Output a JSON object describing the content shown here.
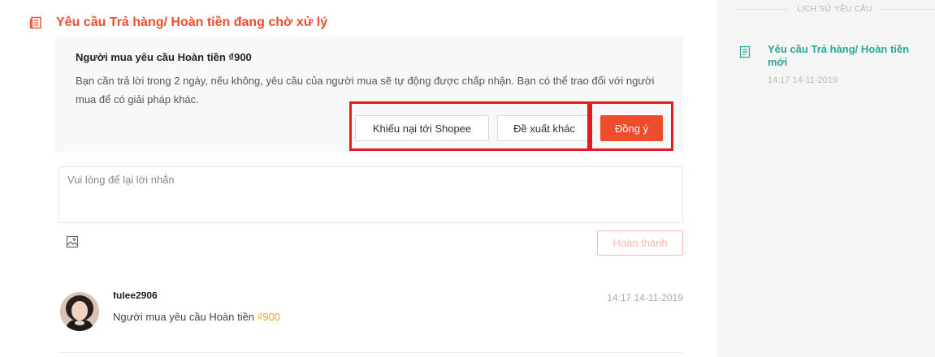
{
  "header": {
    "title": "Yêu cầu Trả hàng/ Hoàn tiền đang chờ xử lý",
    "icon": "document-icon"
  },
  "request": {
    "title": "Người mua yêu cầu Hoàn tiền ₫900",
    "description": "Bạn cần trả lời trong 2 ngày, nếu không, yêu cầu của người mua sẽ tự động được chấp nhận. Bạn có thể trao đổi với người mua để có giải pháp khác.",
    "buttons": {
      "complain": "Khiếu nại tới Shopee",
      "propose": "Đề xuất khác",
      "accept": "Đồng ý"
    }
  },
  "message": {
    "placeholder": "Vui lòng để lại lời nhắn",
    "image_icon": "image-icon",
    "submit_label": "Hoàn thành"
  },
  "history_item": {
    "username": "fulee2906",
    "time": "14:17 14-11-2019",
    "text": "Người mua yêu cầu Hoàn tiền",
    "amount": "₫900"
  },
  "sidebar": {
    "title": "LỊCH SỬ YÊU CẦU",
    "item": {
      "title": "Yêu cầu Trả hàng/ Hoàn tiền mới",
      "time": "14:17 14-11-2019",
      "icon": "document-icon"
    }
  },
  "colors": {
    "brand": "#ee4d2d",
    "teal": "#26aa99",
    "amount": "#f5a623",
    "highlight": "#e31c23"
  }
}
